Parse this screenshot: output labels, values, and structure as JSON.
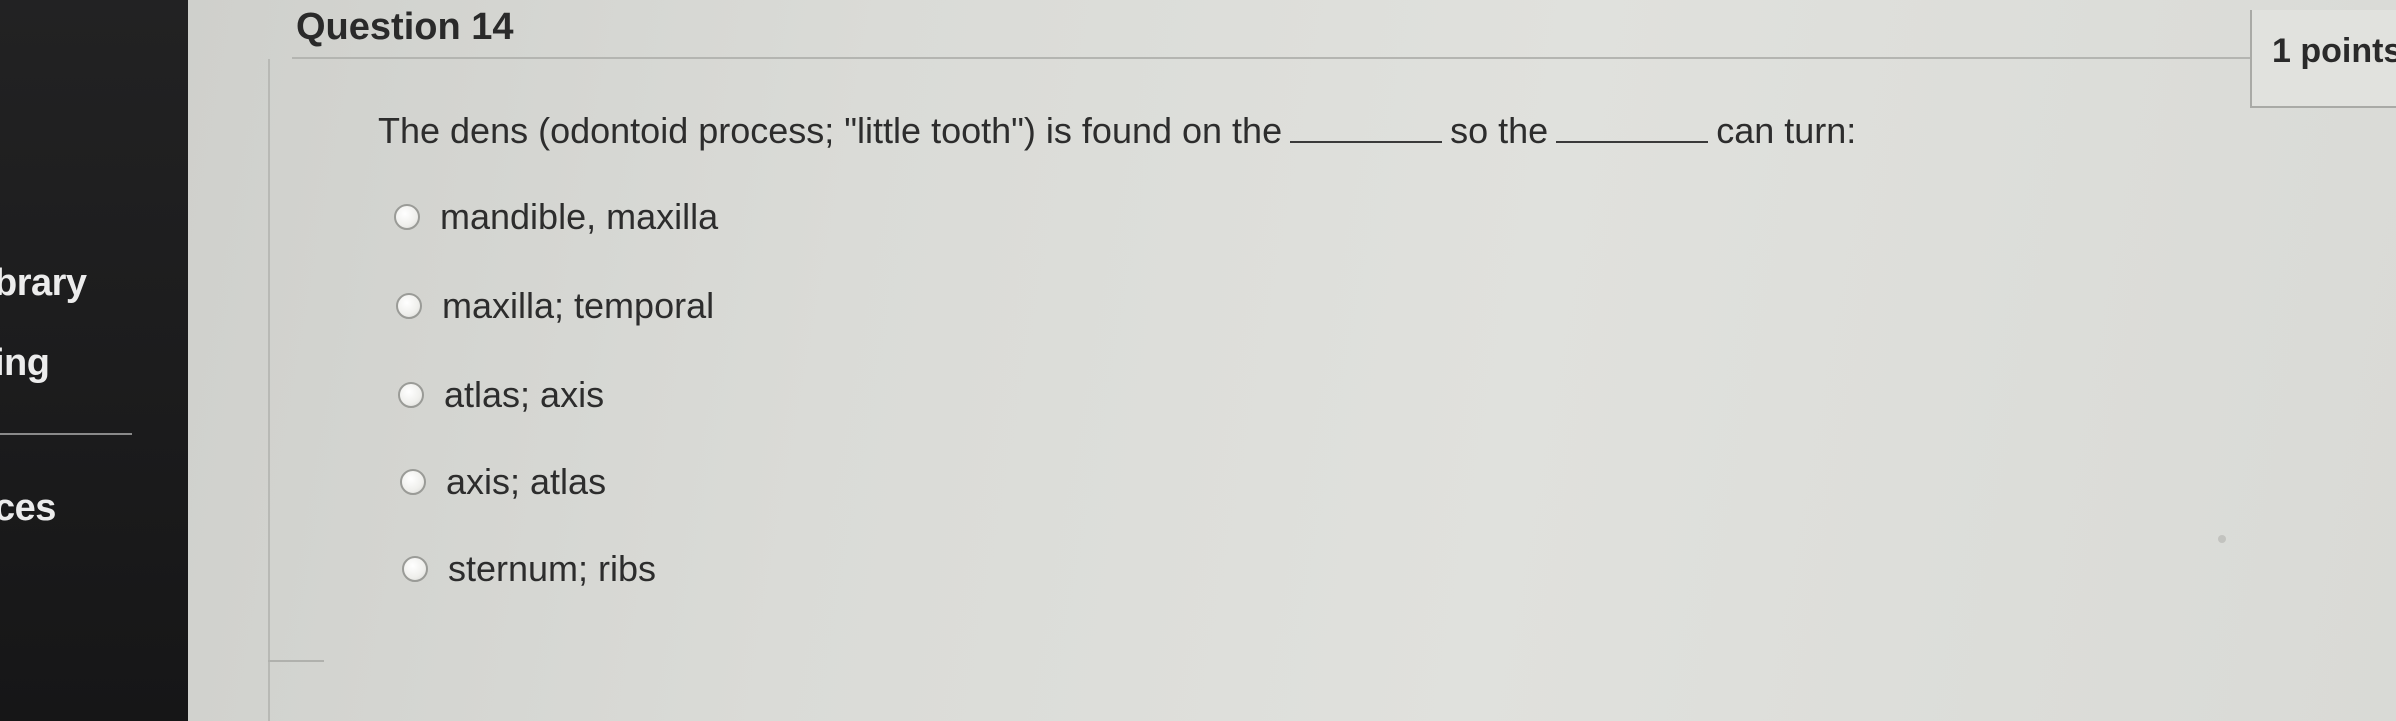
{
  "sidebar": {
    "items": [
      {
        "label": "brary"
      },
      {
        "label": "ing"
      },
      {
        "label": "ces"
      }
    ]
  },
  "question": {
    "title": "Question 14",
    "points": "1 points",
    "text_part1": "The dens (odontoid process; \"little tooth\") is found on the",
    "text_part2": "so the",
    "text_part3": "can turn:",
    "options": [
      {
        "label": "mandible, maxilla"
      },
      {
        "label": "maxilla; temporal"
      },
      {
        "label": "atlas; axis"
      },
      {
        "label": "axis; atlas"
      },
      {
        "label": "sternum; ribs"
      }
    ]
  },
  "colors": {
    "sidebar_bg": "#1b1b1c",
    "content_bg": "#dadbd7",
    "text": "#2d2d2d"
  }
}
